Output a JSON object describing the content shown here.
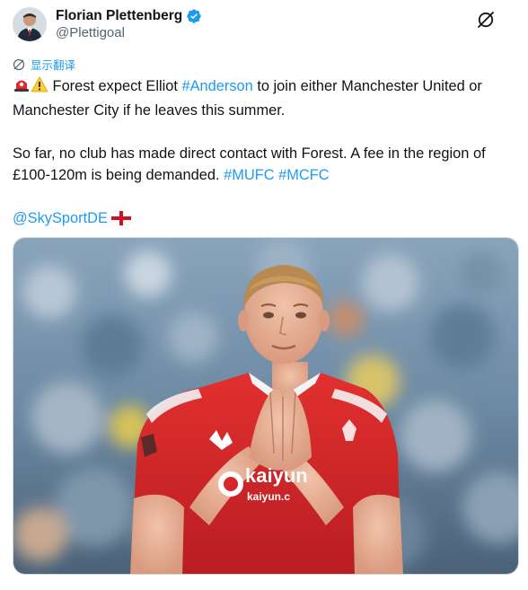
{
  "author": {
    "display_name": "Florian Plettenberg",
    "handle": "@Plettigoal",
    "verified": true
  },
  "actions": {
    "more_icon": "slash-circle-icon"
  },
  "translate": {
    "label": "显示翻译",
    "icon": "translate-icon"
  },
  "tweet": {
    "line1_prefix": " Forest expect Elliot ",
    "hashtag_anderson": "#Anderson",
    "line1_suffix": " to join either Manchester United or Manchester City if he leaves this summer.",
    "para2_text": "So far, no club has made direct contact with Forest. A fee in the region of £100-120m is being demanded. ",
    "hashtag_mufc": "#MUFC",
    "hashtag_mcfc": "#MCFC",
    "mention": "@SkySportDE",
    "emojis": [
      "siren-emoji",
      "warning-emoji",
      "england-flag-emoji"
    ]
  },
  "media": {
    "shirt_sponsor": "kaiyun",
    "shirt_sponsor_url": "kaiyun.c"
  },
  "colors": {
    "link": "#1d9bf0",
    "text": "#0f1419",
    "secondary": "#536471",
    "jersey_red": "#d9262b"
  }
}
